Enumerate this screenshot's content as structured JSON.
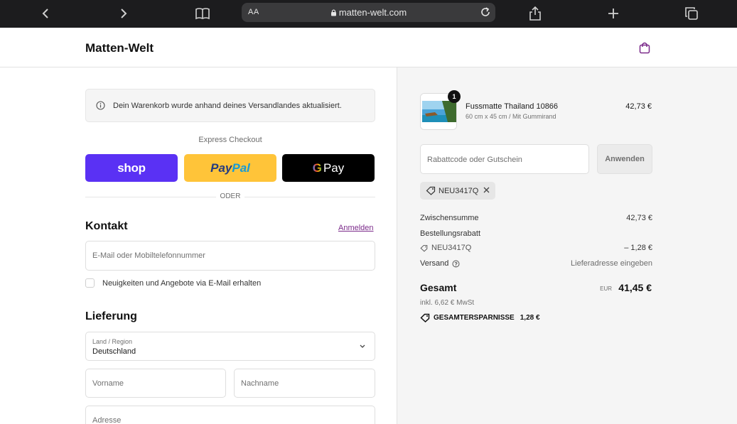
{
  "browser": {
    "text_size_label": "AA",
    "url": "matten-welt.com"
  },
  "store": {
    "name": "Matten-Welt"
  },
  "notice": {
    "text": "Dein Warenkorb wurde anhand deines Versandlandes aktualisiert."
  },
  "express": {
    "title": "Express Checkout",
    "shop_label": "shop",
    "paypal_part1": "Pay",
    "paypal_part2": "Pal",
    "gpay_g": "G",
    "gpay_label": "Pay",
    "divider_label": "ODER"
  },
  "contact": {
    "heading": "Kontakt",
    "login_link": "Anmelden",
    "email_placeholder": "E-Mail oder Mobiltelefonnummer",
    "newsletter_label": "Neuigkeiten und Angebote via E-Mail erhalten"
  },
  "delivery": {
    "heading": "Lieferung",
    "country_label": "Land / Region",
    "country_value": "Deutschland",
    "first_name_placeholder": "Vorname",
    "last_name_placeholder": "Nachname",
    "address_placeholder": "Adresse"
  },
  "summary": {
    "item": {
      "quantity": "1",
      "name": "Fussmatte Thailand 10866",
      "variant": "60 cm x 45 cm / Mit Gummirand",
      "price": "42,73 €"
    },
    "discount_placeholder": "Rabattcode oder Gutschein",
    "apply_label": "Anwenden",
    "applied_code": "NEU3417Q",
    "subtotal_label": "Zwischensumme",
    "subtotal_value": "42,73 €",
    "order_discount_label": "Bestellungsrabatt",
    "order_discount_code": "NEU3417Q",
    "order_discount_value": "– 1,28 €",
    "shipping_label": "Versand",
    "shipping_value": "Lieferadresse eingeben",
    "total_label": "Gesamt",
    "total_currency": "EUR",
    "total_value": "41,45 €",
    "tax_note": "inkl. 6,62 € MwSt",
    "savings_label": "GESAMTERSPARNISSE",
    "savings_value": "1,28 €"
  },
  "colors": {
    "shop_pay": "#5a31f4",
    "paypal": "#ffc439",
    "gpay": "#000000",
    "link": "#7b2a8a"
  }
}
